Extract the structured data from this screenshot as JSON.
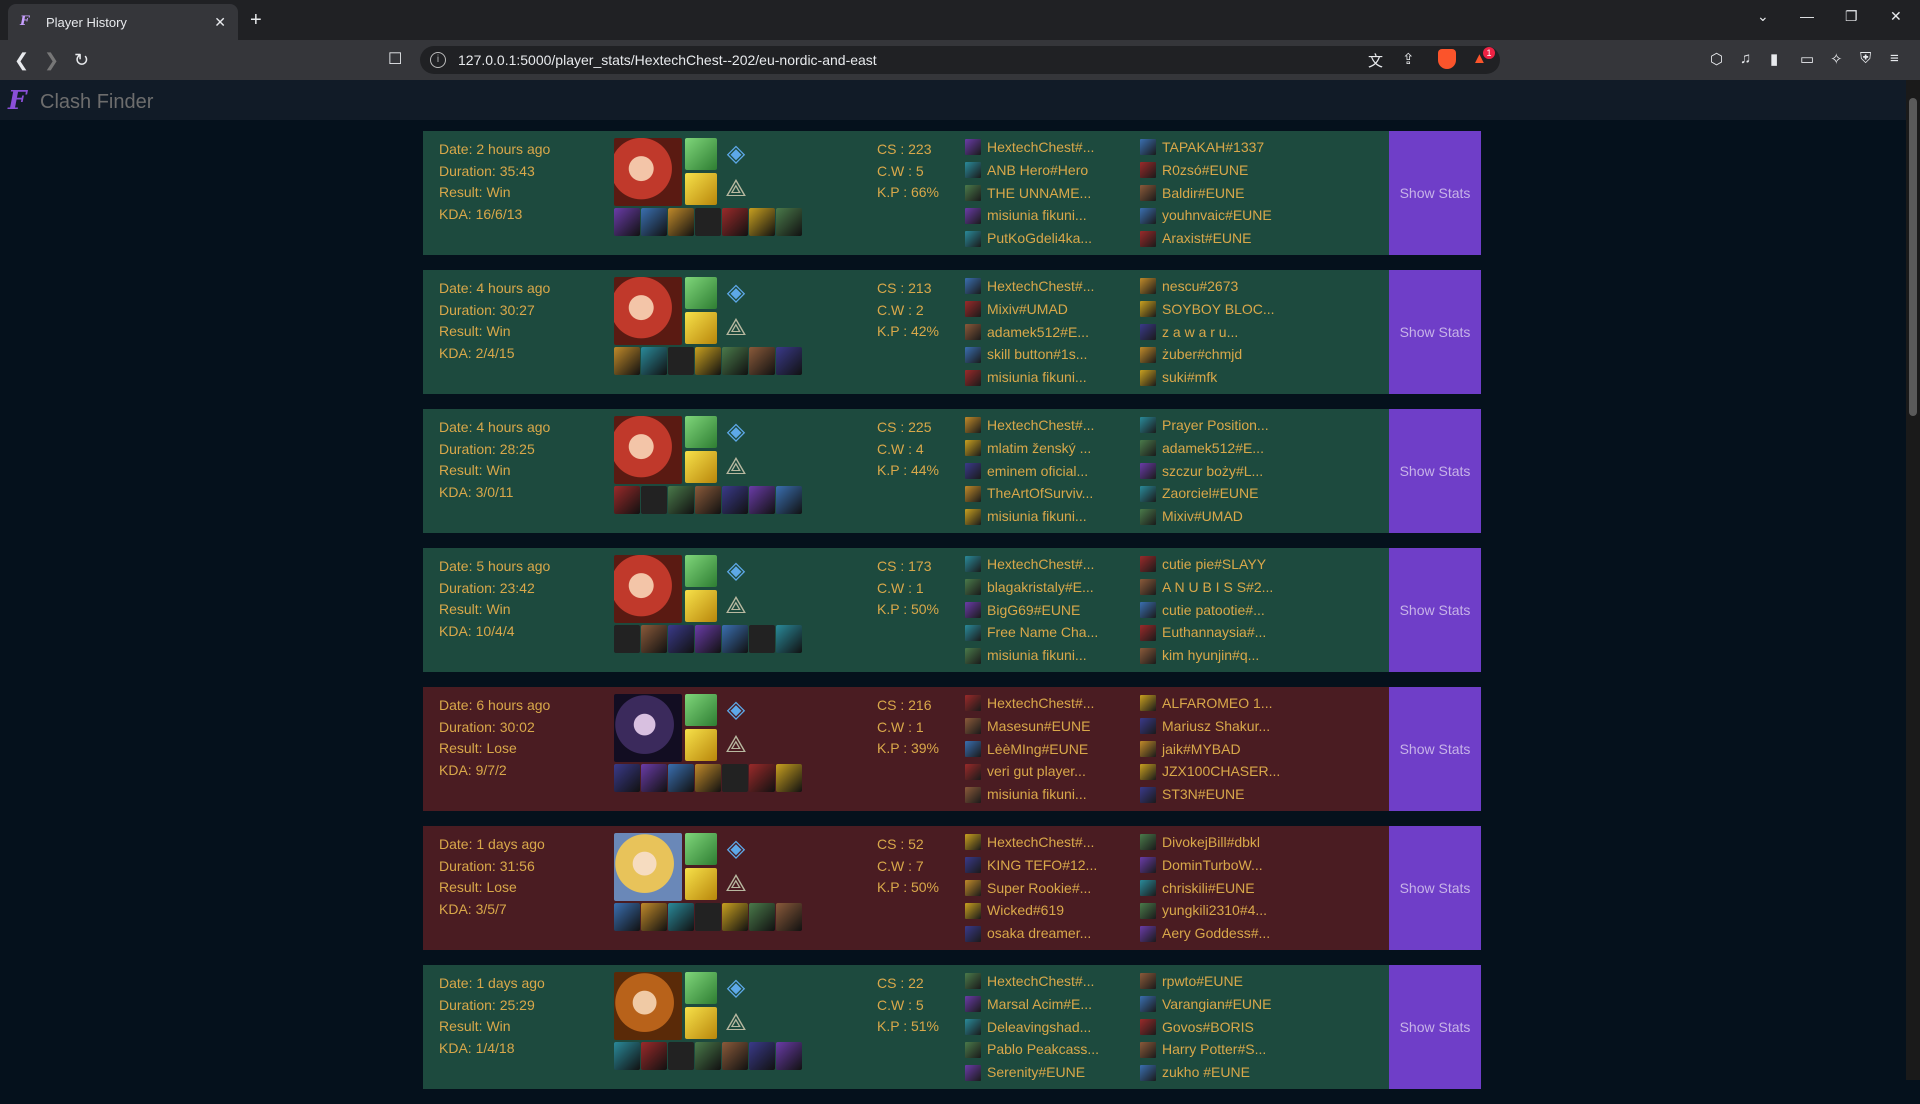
{
  "browser": {
    "tab_title": "Player History",
    "tab_favicon": "F",
    "url": "127.0.0.1:5000/player_stats/HextechChest--202/eu-nordic-and-east",
    "notification_count": "1"
  },
  "app": {
    "logo": "F",
    "name": "Clash Finder"
  },
  "colors": {
    "win_bg": "#1d4a3e",
    "lose_bg": "#4a1c22",
    "text_gold": "#d9a84a",
    "button_purple": "#6f3ec8",
    "page_bg": "#05111c"
  },
  "matches": [
    {
      "result_type": "win",
      "date": "Date: 2 hours ago",
      "duration": "Duration: 35:43",
      "result": "Result: Win",
      "kda": "KDA: 16/6/13",
      "cs": "CS : 223",
      "cw": "C.W : 5",
      "kp": "K.P : 66%",
      "champion": "miss-fortune",
      "team1": [
        "HextechChest#...",
        "ANB Hero#Hero",
        "THE UNNAME...",
        "misiunia fikuni...",
        "PutKoGdeli4ka..."
      ],
      "team2": [
        "TAPAKAH#1337",
        "R0zsó#EUNE",
        "Baldir#EUNE",
        "youhnvaic#EUNE",
        "Araxist#EUNE"
      ],
      "button": "Show Stats"
    },
    {
      "result_type": "win",
      "date": "Date: 4 hours ago",
      "duration": "Duration: 30:27",
      "result": "Result: Win",
      "kda": "KDA: 2/4/15",
      "cs": "CS : 213",
      "cw": "C.W : 2",
      "kp": "K.P : 42%",
      "champion": "miss-fortune",
      "team1": [
        "HextechChest#...",
        "Mixiv#UMAD",
        "adamek512#E...",
        "skill button#1s...",
        "misiunia fikuni..."
      ],
      "team2": [
        "nescu#2673",
        "SOYBOY BLOC...",
        "z a w a r u...",
        "żuber#chmjd",
        "suki#mfk"
      ],
      "button": "Show Stats"
    },
    {
      "result_type": "win",
      "date": "Date: 4 hours ago",
      "duration": "Duration: 28:25",
      "result": "Result: Win",
      "kda": "KDA: 3/0/11",
      "cs": "CS : 225",
      "cw": "C.W : 4",
      "kp": "K.P : 44%",
      "champion": "miss-fortune",
      "team1": [
        "HextechChest#...",
        "mlatim ženský ...",
        "eminem oficial...",
        "TheArtOfSurviv...",
        "misiunia fikuni..."
      ],
      "team2": [
        "Prayer Position...",
        "adamek512#E...",
        "szczur boży#L...",
        "Zaorciel#EUNE",
        "Mixiv#UMAD"
      ],
      "button": "Show Stats"
    },
    {
      "result_type": "win",
      "date": "Date: 5 hours ago",
      "duration": "Duration: 23:42",
      "result": "Result: Win",
      "kda": "KDA: 10/4/4",
      "cs": "CS : 173",
      "cw": "C.W : 1",
      "kp": "K.P : 50%",
      "champion": "miss-fortune",
      "team1": [
        "HextechChest#...",
        "blagakristaly#E...",
        "BigG69#EUNE",
        "Free Name Cha...",
        "misiunia fikuni..."
      ],
      "team2": [
        "cutie pie#SLAYY",
        "A N U B I S S#2...",
        "cutie patootie#...",
        "Euthannaysia#...",
        "kim hyunjin#q..."
      ],
      "button": "Show Stats"
    },
    {
      "result_type": "lose",
      "date": "Date: 6 hours ago",
      "duration": "Duration: 30:02",
      "result": "Result: Lose",
      "kda": "KDA: 9/7/2",
      "cs": "CS : 216",
      "cw": "C.W : 1",
      "kp": "K.P : 39%",
      "champion": "kaisa",
      "team1": [
        "HextechChest#...",
        "Masesun#EUNE",
        "LèèMIng#EUNE",
        "veri gut player...",
        "misiunia fikuni..."
      ],
      "team2": [
        "ALFAROMEO 1...",
        "Mariusz Shakur...",
        "jaik#MYBAD",
        "JZX100CHASER...",
        "ST3N#EUNE"
      ],
      "button": "Show Stats"
    },
    {
      "result_type": "lose",
      "date": "Date: 1 days ago",
      "duration": "Duration: 31:56",
      "result": "Result: Lose",
      "kda": "KDA: 3/5/7",
      "cs": "CS : 52",
      "cw": "C.W : 7",
      "kp": "K.P : 50%",
      "champion": "lux",
      "team1": [
        "HextechChest#...",
        "KING TEFO#12...",
        "Super Rookie#...",
        "Wicked#619",
        "osaka dreamer..."
      ],
      "team2": [
        "DivokejBill#dbkl",
        "DominTurboW...",
        "chriskili#EUNE",
        "yungkili2310#4...",
        "Aery Goddess#..."
      ],
      "button": "Show Stats"
    },
    {
      "result_type": "win",
      "date": "Date: 1 days ago",
      "duration": "Duration: 25:29",
      "result": "Result: Win",
      "kda": "KDA: 1/4/18",
      "cs": "CS : 22",
      "cw": "C.W : 5",
      "kp": "K.P : 51%",
      "champion": "leona",
      "team1": [
        "HextechChest#...",
        "Marsal Acim#E...",
        "Deleavingshad...",
        "Pablo Peakcass...",
        "Serenity#EUNE"
      ],
      "team2": [
        "rpwto#EUNE",
        "Varangian#EUNE",
        "Govos#BORIS",
        "Harry Potter#S...",
        "zukho #EUNE"
      ],
      "button": "Show Stats"
    }
  ]
}
